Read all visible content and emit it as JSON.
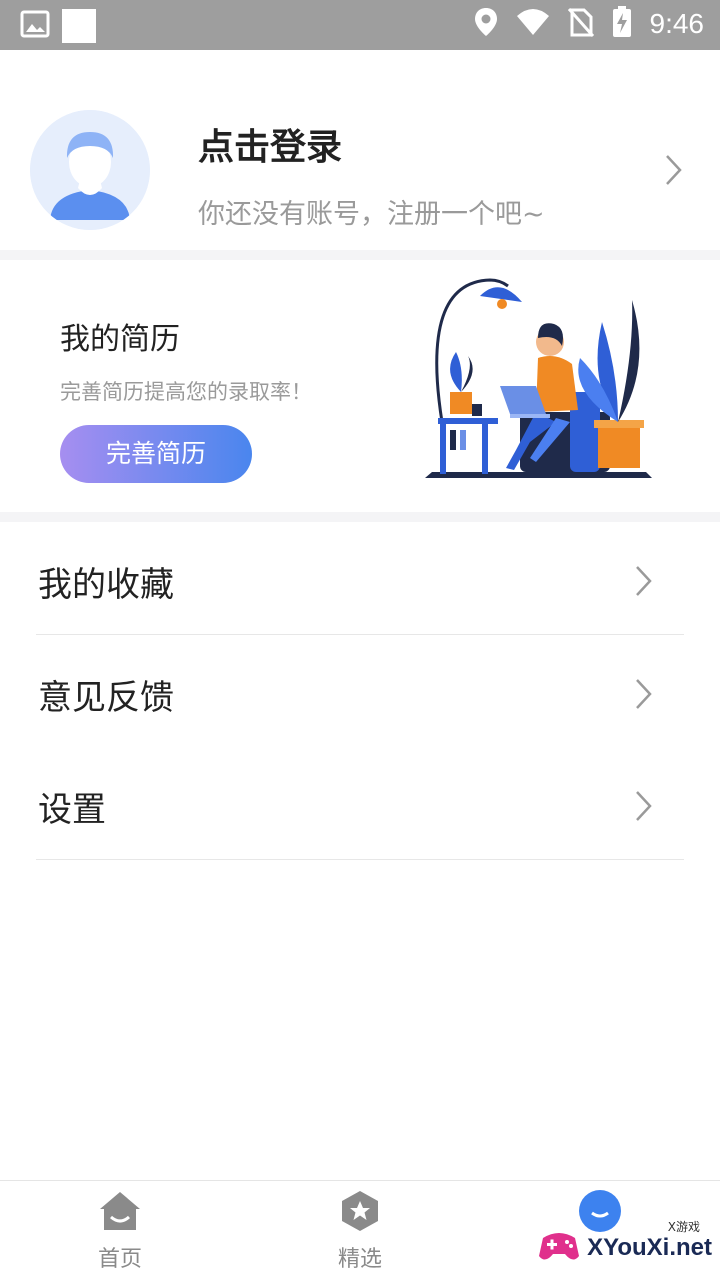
{
  "status_bar": {
    "time": "9:46",
    "icons": [
      "image-icon",
      "location-icon",
      "wifi-icon",
      "no-sim-icon",
      "battery-charging-icon"
    ]
  },
  "profile": {
    "login_title": "点击登录",
    "login_subtitle": "你还没有账号，注册一个吧~"
  },
  "resume": {
    "title": "我的简历",
    "subtitle": "完善简历提高您的录取率！",
    "button_label": "完善简历"
  },
  "menu": {
    "items": [
      {
        "label": "我的收藏"
      },
      {
        "label": "意见反馈"
      },
      {
        "label": "设置"
      }
    ]
  },
  "bottom_nav": {
    "tabs": [
      {
        "label": "首页",
        "icon": "home-icon"
      },
      {
        "label": "精选",
        "icon": "star-badge-icon"
      },
      {
        "label": "",
        "icon": "profile-icon",
        "active": true
      }
    ]
  },
  "watermark": {
    "text": "XYouXi.net",
    "small": "X游戏"
  },
  "colors": {
    "accent_blue": "#4a86ee",
    "gradient_start": "#a68ef0",
    "status_bar": "#9e9e9e"
  }
}
